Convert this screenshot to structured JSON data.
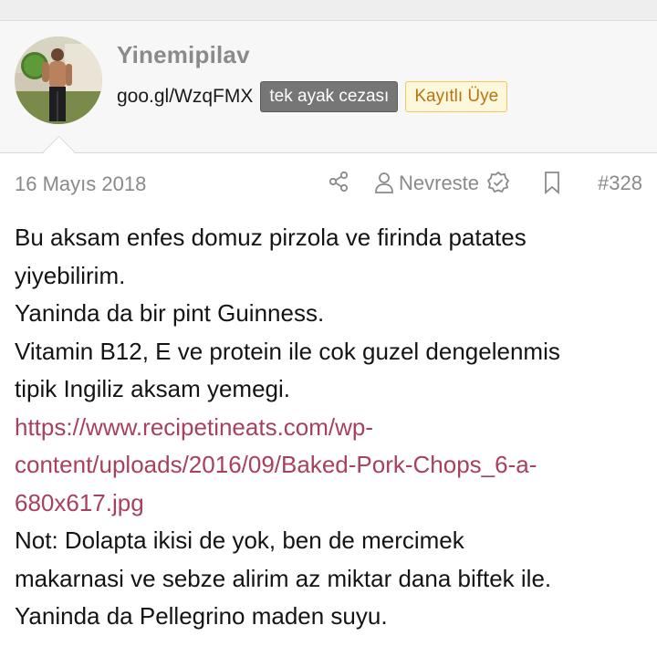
{
  "user": {
    "name": "Yinemipilav",
    "title": "goo.gl/WzqFMX",
    "banners": [
      "tek ayak cezası",
      "Kayıtlı Üye"
    ]
  },
  "post": {
    "date": "16 Mayıs 2018",
    "reactor": "Nevreste",
    "number": "#328",
    "lines": [
      "Bu aksam enfes domuz pirzola ve firinda patates",
      "yiyebilirim.",
      "Yaninda da bir pint Guinness.",
      "Vitamin B12, E ve protein ile cok guzel dengelenmis",
      "tipik Ingiliz aksam yemegi."
    ],
    "link_lines": [
      "https://www.recipetineats.com/wp-",
      "content/uploads/2016/09/Baked-Pork-Chops_6-a-",
      "680x617.jpg"
    ],
    "after_lines": [
      "Not: Dolapta ikisi de yok, ben de mercimek",
      "makarnasi ve sebze alirim az miktar dana biftek ile.",
      "Yaninda da Pellegrino maden suyu."
    ]
  },
  "icons": {
    "share": "share-icon",
    "person": "person-icon",
    "verified": "verified-icon",
    "bookmark": "bookmark-icon"
  },
  "colors": {
    "username": "#8a8a8a",
    "link": "#a7415c",
    "banner_gray": "#767676",
    "banner_yellow_bg": "#fdf7dc",
    "banner_yellow_text": "#b57611"
  }
}
